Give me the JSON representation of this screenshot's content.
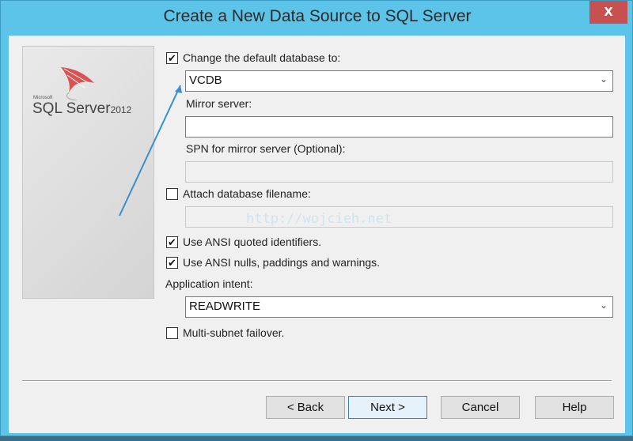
{
  "window": {
    "title": "Create a New Data Source to SQL Server",
    "close_label": "X"
  },
  "logo": {
    "microsoft": "Microsoft",
    "product": "SQL Server",
    "year": "2012"
  },
  "form": {
    "change_db": {
      "label": "Change the default database to:",
      "checked": true,
      "value": "VCDB"
    },
    "mirror_server": {
      "label": "Mirror server:",
      "value": ""
    },
    "spn": {
      "label": "SPN for mirror server (Optional):",
      "value": ""
    },
    "attach_db": {
      "label": "Attach database filename:",
      "checked": false,
      "value": ""
    },
    "ansi_quoted": {
      "label": "Use ANSI quoted identifiers.",
      "checked": true
    },
    "ansi_nulls": {
      "label": "Use ANSI nulls, paddings and warnings.",
      "checked": true
    },
    "app_intent": {
      "label": "Application intent:",
      "value": "READWRITE"
    },
    "multi_subnet": {
      "label": "Multi-subnet failover.",
      "checked": false
    }
  },
  "watermark": "http://wojcieh.net",
  "buttons": {
    "back": "< Back",
    "next": "Next >",
    "cancel": "Cancel",
    "help": "Help"
  },
  "colors": {
    "frame": "#5cc4e8",
    "close": "#c75050",
    "arrow": "#3a8fd0"
  }
}
